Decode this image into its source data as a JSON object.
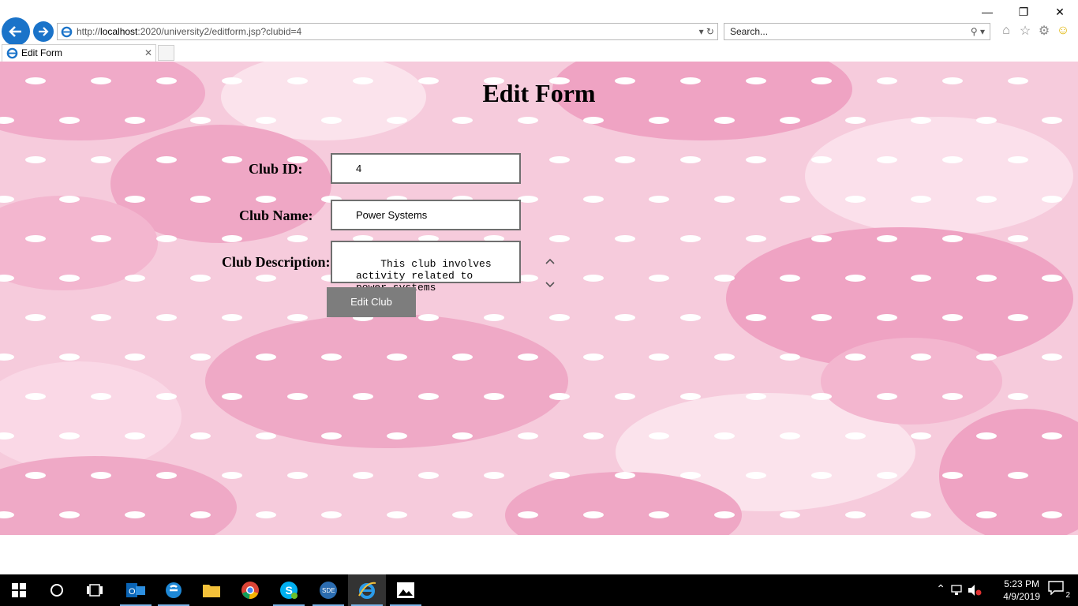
{
  "browser": {
    "url_prefix": "http://",
    "url_host": "localhost",
    "url_rest": ":2020/university2/editform.jsp?clubid=4",
    "search_placeholder": "Search...",
    "tab_title": "Edit Form"
  },
  "page": {
    "heading": "Edit Form",
    "club_id_label": "Club ID:",
    "club_id_value": "4",
    "club_name_label": "Club Name:",
    "club_name_value": "Power Systems",
    "club_desc_label": "Club Description:",
    "club_desc_value": "This club involves\nactivity related to\npower systems",
    "submit_label": "Edit Club"
  },
  "taskbar": {
    "time": "5:23 PM",
    "date": "4/9/2019",
    "notification_count": "2",
    "apps": [
      "outlook",
      "edge",
      "file-explorer",
      "chrome",
      "skype",
      "sde",
      "internet-explorer",
      "photos"
    ]
  },
  "colors": {
    "background_pink": "#f6cbdc",
    "rose_pink": "#ee9fc0",
    "button_gray": "#7d7d7d",
    "ie_blue": "#1a73c9"
  }
}
